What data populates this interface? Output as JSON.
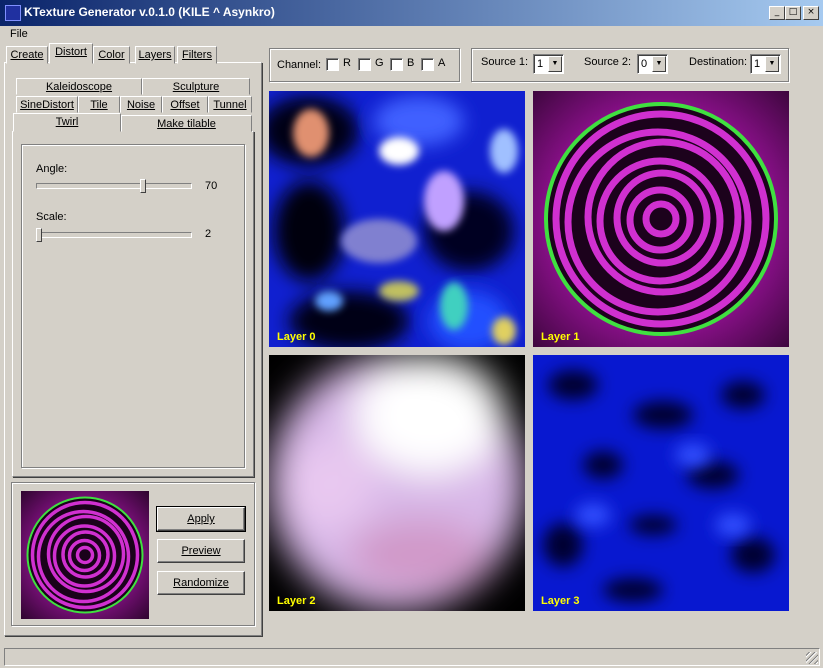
{
  "window": {
    "title": "KTexture Generator v.0.1.0 (KILE ^ Asynkro)",
    "controls": {
      "minimize": "_",
      "maximize": "□",
      "close": "×"
    }
  },
  "menu": {
    "file": "File"
  },
  "main_tabs": [
    {
      "label": "Create"
    },
    {
      "label": "Distort",
      "active": true
    },
    {
      "label": "Color"
    },
    {
      "label": "Layers"
    },
    {
      "label": "Filters"
    }
  ],
  "distort_tabs": {
    "row1": [
      {
        "label": "Kaleidoscope"
      },
      {
        "label": "Sculpture"
      }
    ],
    "row2": [
      {
        "label": "SineDistort"
      },
      {
        "label": "Tile"
      },
      {
        "label": "Noise"
      },
      {
        "label": "Offset"
      },
      {
        "label": "Tunnel"
      }
    ],
    "row3": [
      {
        "label": "Twirl",
        "active": true
      },
      {
        "label": "Make tilable"
      }
    ]
  },
  "twirl": {
    "angle": {
      "label": "Angle:",
      "value": "70",
      "level": 0.7
    },
    "scale": {
      "label": "Scale:",
      "value": "2",
      "level": 0.0
    }
  },
  "actions": {
    "apply": "Apply",
    "preview": "Preview",
    "randomize": "Randomize"
  },
  "channel": {
    "label": "Channel:",
    "r": "R",
    "g": "G",
    "b": "B",
    "a": "A"
  },
  "sources": {
    "source1_label": "Source 1:",
    "source1_value": "1",
    "source2_label": "Source 2:",
    "source2_value": "0",
    "destination_label": "Destination:",
    "destination_value": "1"
  },
  "layers": [
    {
      "label": "Layer 0"
    },
    {
      "label": "Layer 1"
    },
    {
      "label": "Layer 2"
    },
    {
      "label": "Layer 3"
    }
  ],
  "colors": {
    "title_start": "#0a246a",
    "title_end": "#a6caf0",
    "layer_label": "#ffff00",
    "face": "#d4d0c8"
  }
}
